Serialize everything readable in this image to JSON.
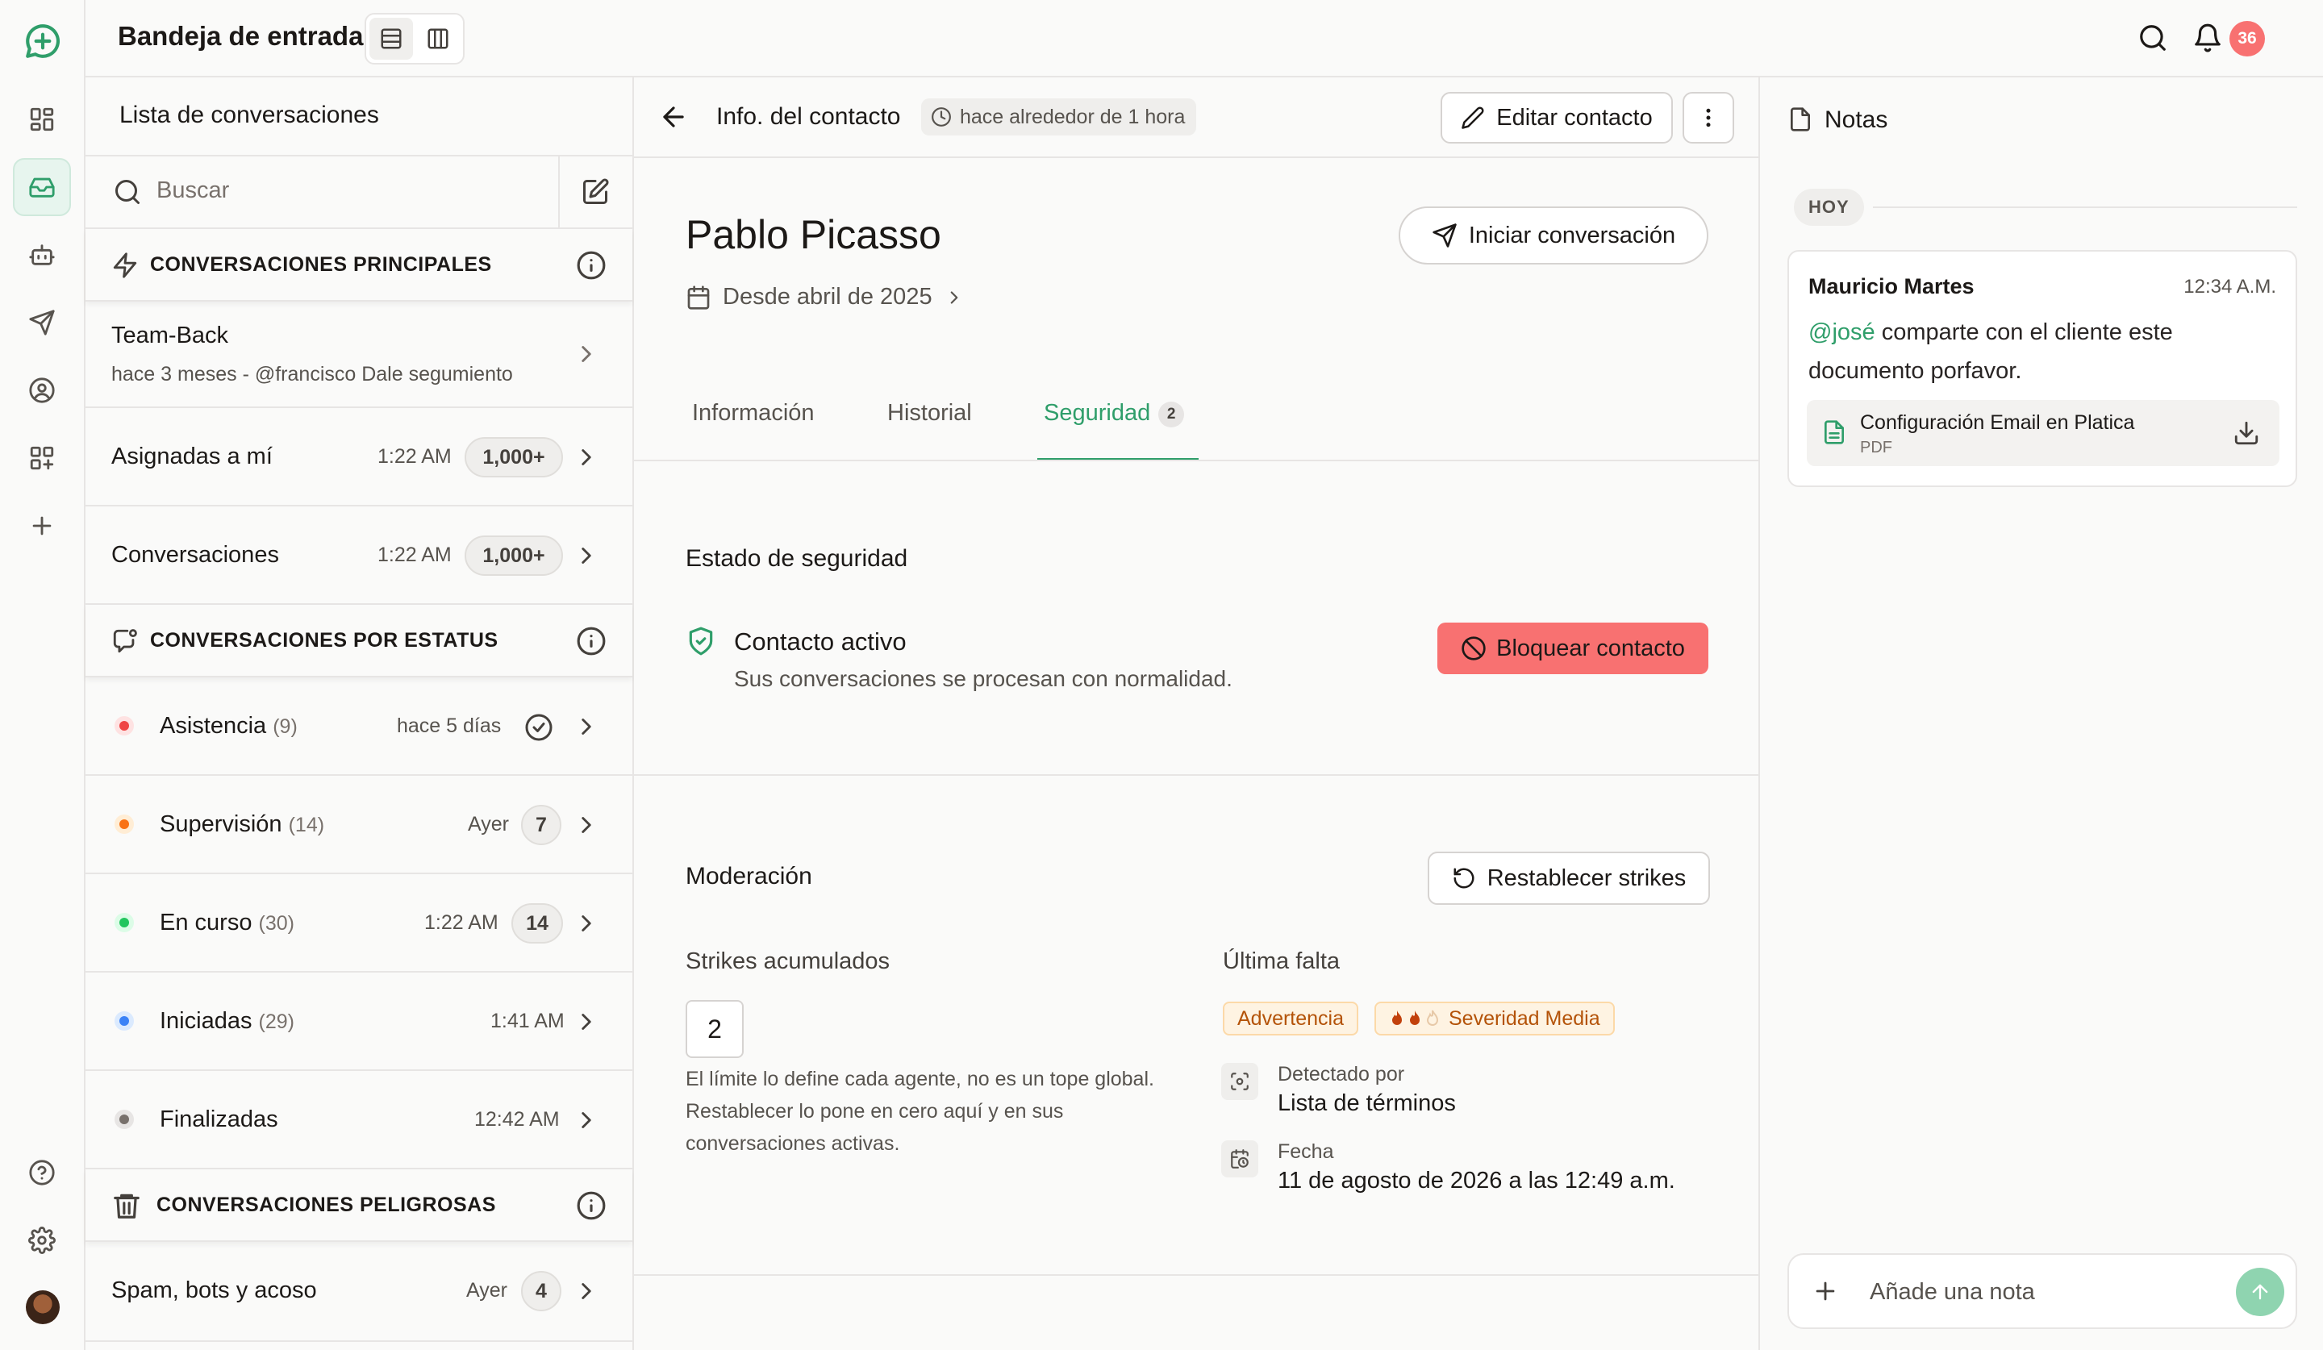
{
  "topbar": {
    "title": "Bandeja de entrada",
    "notification_count": "36"
  },
  "sidebar": {
    "header": "Lista de conversaciones",
    "search_placeholder": "Buscar",
    "sections": {
      "main": "CONVERSACIONES PRINCIPALES",
      "status": "CONVERSACIONES POR ESTATUS",
      "dangerous": "CONVERSACIONES PELIGROSAS"
    },
    "team": {
      "name": "Team-Back",
      "subtitle": "hace 3 meses - @francisco Dale segumiento"
    },
    "assigned": {
      "label": "Asignadas a mí",
      "time": "1:22 AM",
      "count": "1,000+"
    },
    "all": {
      "label": "Conversaciones",
      "time": "1:22 AM",
      "count": "1,000+"
    },
    "status_items": [
      {
        "label": "Asistencia",
        "count": "(9)",
        "time": "hace 5 días",
        "color": "#ef4444"
      },
      {
        "label": "Supervisión",
        "count": "(14)",
        "time": "Ayer",
        "badge": "7",
        "color": "#f97316"
      },
      {
        "label": "En curso",
        "count": "(30)",
        "time": "1:22 AM",
        "badge": "14",
        "color": "#22c55e"
      },
      {
        "label": "Iniciadas",
        "count": "(29)",
        "time": "1:41 AM",
        "color": "#3b82f6"
      },
      {
        "label": "Finalizadas",
        "count": "",
        "time": "12:42 AM",
        "color": "#78716c"
      }
    ],
    "spam": {
      "label": "Spam, bots y acoso",
      "time": "Ayer",
      "badge": "4"
    }
  },
  "contact": {
    "header": "Info. del contacto",
    "updated": "hace alrededor de 1 hora",
    "edit_label": "Editar contacto",
    "name": "Pablo Picasso",
    "since": "Desde abril de 2025",
    "start_label": "Iniciar conversación",
    "tabs": {
      "info": "Información",
      "history": "Historial",
      "security": "Seguridad",
      "security_count": "2"
    },
    "security": {
      "title": "Estado de seguridad",
      "status": "Contacto activo",
      "status_desc": "Sus conversaciones se procesan con normalidad.",
      "block_label": "Bloquear contacto"
    },
    "moderation": {
      "title": "Moderación",
      "reset_label": "Restablecer strikes",
      "strikes_label": "Strikes acumulados",
      "strikes_value": "2",
      "strikes_help": "El límite lo define cada agente, no es un tope global. Restablecer lo pone en cero aquí y en sus conversaciones activas.",
      "last_label": "Última falta",
      "tag_warning": "Advertencia",
      "tag_severity": "Severidad Media",
      "detected_label": "Detectado por",
      "detected_value": "Lista de términos",
      "date_label": "Fecha",
      "date_value": "11 de agosto de 2026 a las 12:49 a.m."
    }
  },
  "notes": {
    "title": "Notas",
    "day": "HOY",
    "note": {
      "author": "Mauricio Martes",
      "time": "12:34 A.M.",
      "mention": "@josé",
      "text": " comparte con el cliente este documento porfavor.",
      "file_name": "Configuración Email en Platica",
      "file_type": "PDF"
    },
    "input_placeholder": "Añade una nota"
  },
  "colors": {
    "accent": "#2f9e6a",
    "danger": "#f87171",
    "badge": "#f87171"
  }
}
